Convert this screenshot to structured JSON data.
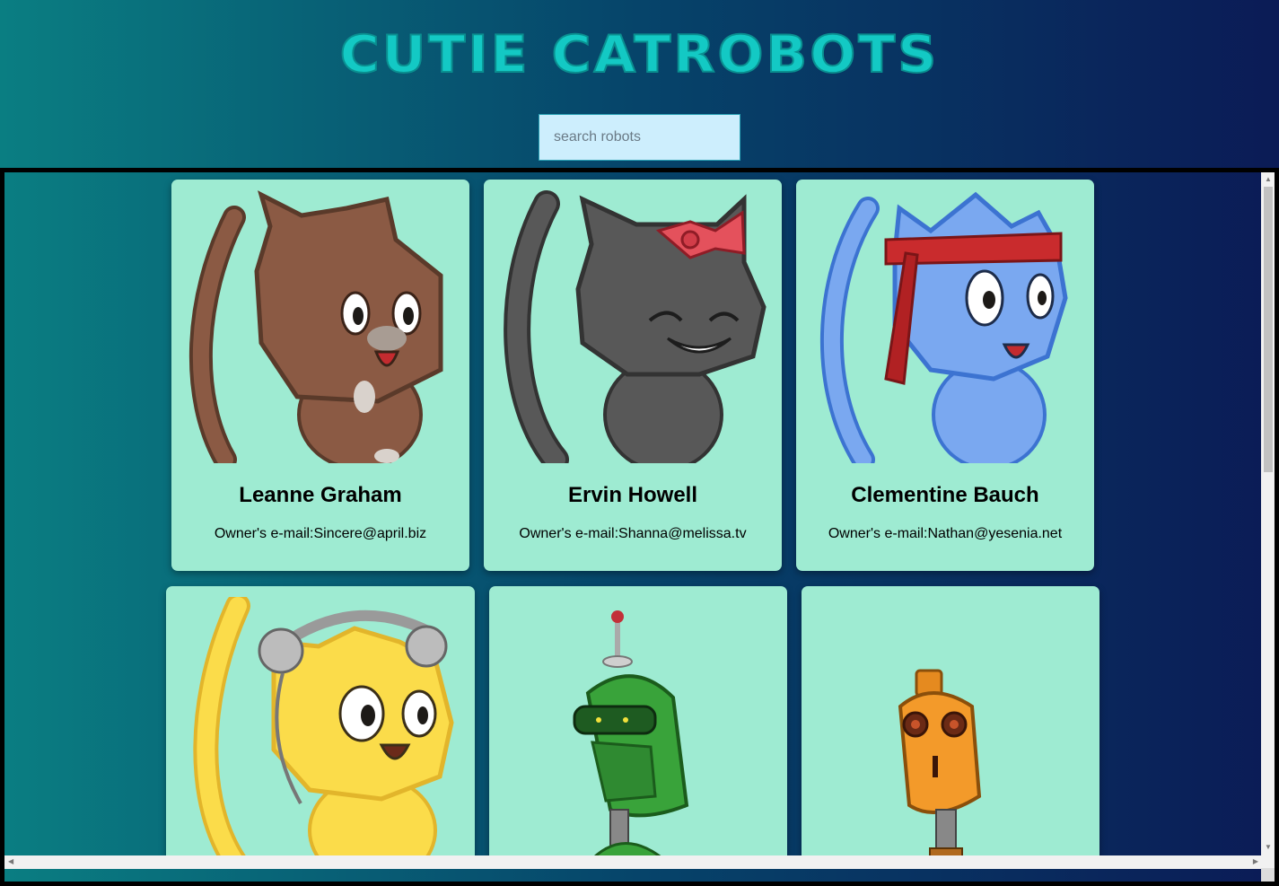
{
  "header": {
    "title": "CUTIE CATROBOTS"
  },
  "search": {
    "placeholder": "search robots",
    "value": ""
  },
  "robots": [
    {
      "name": "Leanne Graham",
      "email_text": "Owner's e-mail:Sincere@april.biz",
      "image": "brown-cat"
    },
    {
      "name": "Ervin Howell",
      "email_text": "Owner's e-mail:Shanna@melissa.tv",
      "image": "grey-cat-bow"
    },
    {
      "name": "Clementine Bauch",
      "email_text": "Owner's e-mail:Nathan@yesenia.net",
      "image": "blue-cat-headband"
    },
    {
      "name": "",
      "email_text": "",
      "image": "yellow-cat-headphones"
    },
    {
      "name": "",
      "email_text": "",
      "image": "green-robot"
    },
    {
      "name": "",
      "email_text": "",
      "image": "orange-robot"
    }
  ],
  "colors": {
    "card_bg": "#9eebd2",
    "title": "#13c9c4",
    "gradient_start": "#0a7e82",
    "gradient_end": "#0b1b56"
  }
}
